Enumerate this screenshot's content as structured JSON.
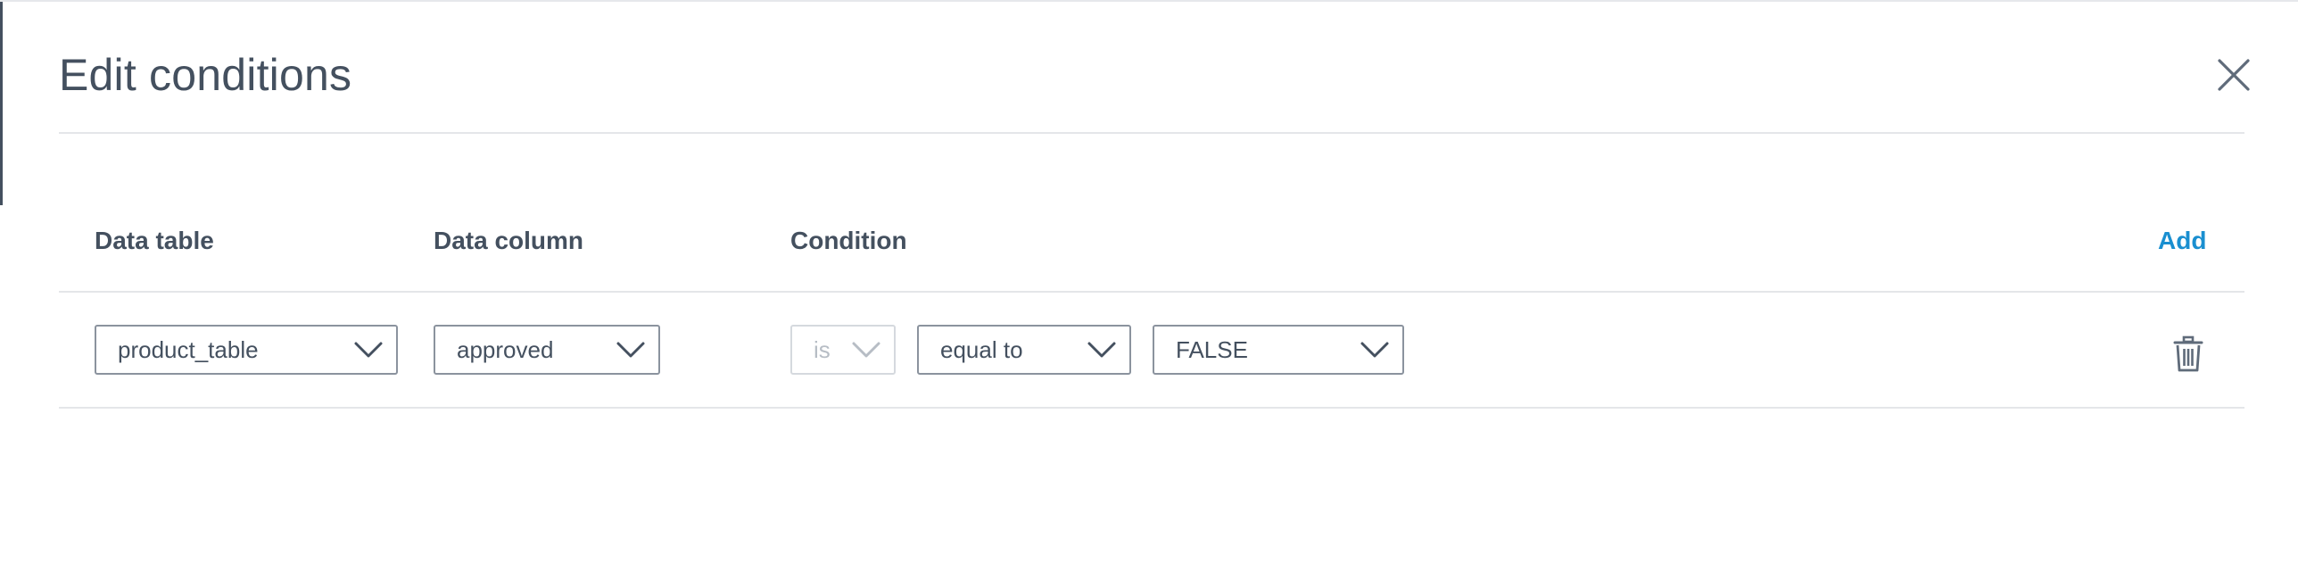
{
  "dialog": {
    "title": "Edit conditions",
    "close_icon": "close-icon"
  },
  "table": {
    "headers": {
      "data_table": "Data table",
      "data_column": "Data column",
      "condition": "Condition"
    },
    "add_label": "Add",
    "rows": [
      {
        "data_table": "product_table",
        "data_column": "approved",
        "qualifier": "is",
        "operator": "equal to",
        "value": "FALSE",
        "delete_icon": "trash-icon"
      }
    ]
  },
  "colors": {
    "text": "#44505f",
    "link": "#1a8fd0",
    "divider": "#e4e6e9",
    "select_border": "#8b939e",
    "disabled": "#b7bdc5"
  }
}
